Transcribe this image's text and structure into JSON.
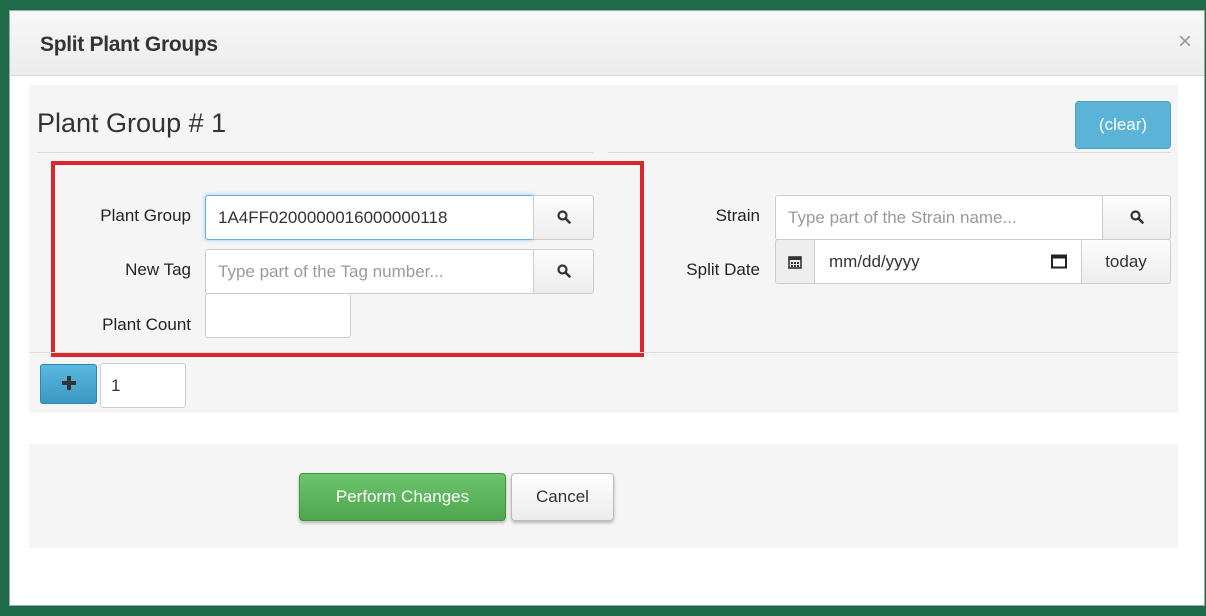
{
  "dialog": {
    "title": "Split Plant Groups",
    "close_glyph": "×"
  },
  "group": {
    "title": "Plant Group # 1",
    "clear_label": "(clear)"
  },
  "form": {
    "plant_group": {
      "label": "Plant Group",
      "value": "1A4FF0200000016000000118",
      "placeholder": ""
    },
    "new_tag": {
      "label": "New Tag",
      "value": "",
      "placeholder": "Type part of the Tag number..."
    },
    "plant_count": {
      "label": "Plant Count",
      "value": ""
    },
    "strain": {
      "label": "Strain",
      "value": "",
      "placeholder": "Type part of the Strain name..."
    },
    "split_date": {
      "label": "Split Date",
      "value": "mm/dd/yyyy",
      "today_label": "today"
    }
  },
  "add_row": {
    "count": "1"
  },
  "actions": {
    "perform_label": "Perform Changes",
    "cancel_label": "Cancel"
  },
  "colors": {
    "highlight": "#d9262a",
    "accent_blue": "#5bb4d8",
    "accent_green": "#5cb85c",
    "backdrop": "#1f6b48"
  },
  "icons": [
    "search-icon",
    "calendar-icon",
    "plus-icon",
    "close-icon"
  ]
}
